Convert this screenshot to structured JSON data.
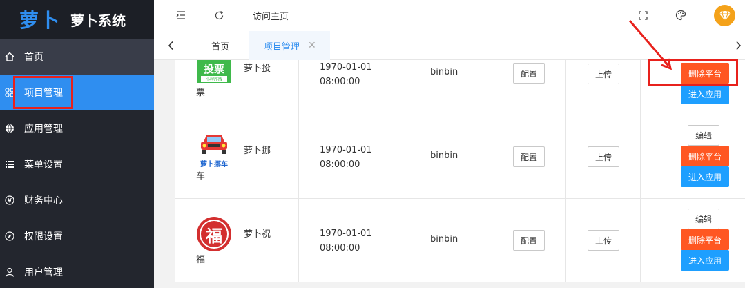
{
  "app": {
    "logo_mark": "萝卜",
    "title": "萝卜系统"
  },
  "sidebar": {
    "items": [
      {
        "label": "首页",
        "icon": "home-icon"
      },
      {
        "label": "项目管理",
        "icon": "grid-icon"
      },
      {
        "label": "应用管理",
        "icon": "globe-icon"
      },
      {
        "label": "菜单设置",
        "icon": "list-icon"
      },
      {
        "label": "财务中心",
        "icon": "yen-icon"
      },
      {
        "label": "权限设置",
        "icon": "compass-icon"
      },
      {
        "label": "用户管理",
        "icon": "user-icon"
      }
    ]
  },
  "topbar": {
    "visit_label": "访问主页"
  },
  "tabs": [
    {
      "label": "首页"
    },
    {
      "label": "项目管理",
      "close": "✕"
    }
  ],
  "rows": [
    {
      "name_line1": "萝卜投",
      "name_line2": "票",
      "logo_text_top": "投票",
      "logo_text_bottom": "小程序版",
      "time_line1": "1970-01-01",
      "time_line2": "08:00:00",
      "user": "binbin",
      "config": "配置",
      "upload": "上传",
      "delete": "删除平台",
      "enter": "进入应用"
    },
    {
      "name_line1": "萝卜挪",
      "name_line2": "车",
      "logo_text_bottom": "萝卜挪车",
      "time_line1": "1970-01-01",
      "time_line2": "08:00:00",
      "user": "binbin",
      "config": "配置",
      "upload": "上传",
      "edit": "编辑",
      "delete": "删除平台",
      "enter": "进入应用"
    },
    {
      "name_line1": "萝卜祝",
      "name_line2": "福",
      "logo_text_top": "福",
      "time_line1": "1970-01-01",
      "time_line2": "08:00:00",
      "user": "binbin",
      "config": "配置",
      "upload": "上传",
      "edit": "编辑",
      "delete": "删除平台",
      "enter": "进入应用"
    }
  ],
  "colors": {
    "sidebar": "#23262e",
    "accent": "#2f8ef0",
    "danger": "#ff5722",
    "primary": "#1e9fff",
    "annotation": "#e8211c"
  }
}
